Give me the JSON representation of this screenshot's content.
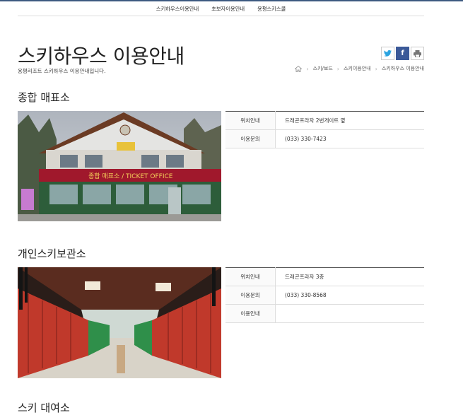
{
  "nav": {
    "items": [
      "스키하우스이용안내",
      "초보자이용안내",
      "용평스키스쿨"
    ]
  },
  "page": {
    "title": "스키하우스 이용안내",
    "subtitle": "용평리조트 스키하우스 이용안내입니다."
  },
  "share": {
    "twitter_icon": "twitter-icon",
    "facebook_icon": "facebook-icon",
    "print_icon": "print-icon"
  },
  "breadcrumb": {
    "items": [
      "스키/보드",
      "스키이용안내",
      "스키하우스 이용안내"
    ]
  },
  "sections": [
    {
      "title": "종합 매표소",
      "photo_sign_text": "종합 매표소 / TICKET OFFICE",
      "rows": [
        {
          "label": "위치안내",
          "value": "드래곤프라자 2번게이트 옆"
        },
        {
          "label": "이용문의",
          "value": "(033) 330-7423"
        }
      ]
    },
    {
      "title": "개인스키보관소",
      "rows": [
        {
          "label": "위치안내",
          "value": "드래곤프라자 3층"
        },
        {
          "label": "이용문의",
          "value": "(033) 330-8568"
        },
        {
          "label": "이용안내",
          "value": ""
        }
      ]
    }
  ],
  "next_section_partial": "스키 대여소"
}
